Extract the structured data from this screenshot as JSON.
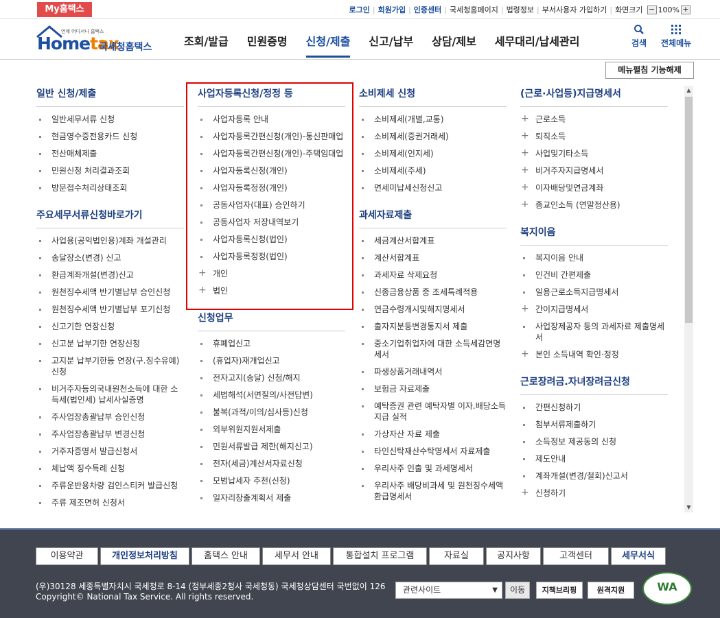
{
  "topbar": {
    "my_tab": "My홈택스",
    "links": [
      "로그인",
      "회원가입",
      "인증센터",
      "국세청홈페이지",
      "법령정보",
      "부서사용자 가입하기",
      "화면크기"
    ],
    "zoom": "100%"
  },
  "header": {
    "logo_small": "언제 어디서나 홈택스",
    "logo_text_1": "Home",
    "logo_text_2": "tax",
    "logo_kr": "국세청홈택스",
    "nav": [
      "조회/발급",
      "민원증명",
      "신청/제출",
      "신고/납부",
      "상담/제보",
      "세무대리/납세관리"
    ],
    "search_label": "검색",
    "allmenu_label": "전체메뉴"
  },
  "fold_button": "메뉴펼침 기능해제",
  "columns": [
    {
      "groups": [
        {
          "title": "일반 신청/제출",
          "items": [
            "일반세무서류 신청",
            "현금영수증전용카드 신청",
            "전산매체제출",
            "민원신청 처리결과조회",
            "방문접수처리상태조회"
          ]
        },
        {
          "title": "주요세무서류신청바로가기",
          "items": [
            "사업용(공익법인용)계좌 개설관리",
            "송달장소(변경) 신고",
            "환급계좌개설(변경)신고",
            "원천징수세액 반기별납부 승인신청",
            "원천징수세액 반기별납부 포기신청",
            "신고기한 연장신청",
            "신고분 납부기한 연장신청",
            "고지분 납부기한등 연장(구.징수유예) 신청",
            "비거주자등의국내원천소득에 대한 소득세(법인세) 납세사실증명",
            "주사업장총괄납부 승인신청",
            "주사업장총괄납부 변경신청",
            "거주자증명서 발급신청서",
            "체납액 징수특례 신청",
            "주류운반용차량 검인스티커 발급신청",
            "주류 제조면허 신청서"
          ]
        }
      ]
    },
    {
      "groups": [
        {
          "title": "사업자등록신청/정정 등",
          "items": [
            "사업자등록 안내",
            "사업자등록간편신청(개인)-통신판매업",
            "사업자등록간편신청(개인)-주택임대업",
            "사업자등록신청(개인)",
            "사업자등록정정(개인)",
            "공동사업자(대표) 승인하기",
            "공동사업자 저장내역보기",
            "사업자등록신청(법인)",
            "사업자등록정정(법인)",
            "개인",
            "법인"
          ],
          "plus": [
            9,
            10
          ]
        },
        {
          "title": "신청업무",
          "items": [
            "휴폐업신고",
            "(휴업자)재개업신고",
            "전자고지(송달) 신청/해지",
            "세법해석(서면질의/사전답변)",
            "불복(과적/이의/심사등)신청",
            "외부위원지원서제출",
            "민원서류발급 제한(해지신고)",
            "전자(세금)계산서자료신청",
            "모범납세자 추천(신청)",
            "일자리창출계획서 제출"
          ]
        }
      ]
    },
    {
      "groups": [
        {
          "title": "소비제세 신청",
          "items": [
            "소비제세(개별,교통)",
            "소비제세(증권거래세)",
            "소비제세(인지세)",
            "소비제세(주세)",
            "면세미납세신청신고"
          ]
        },
        {
          "title": "과세자료제출",
          "items": [
            "세금계산서합계표",
            "계산서합계표",
            "과세자료 삭제요청",
            "신종금융상품 중 조세특례적용",
            "연금수령개시및해지명세서",
            "출자지분등변경통지서 제출",
            "중소기업취업자에 대한 소득세감면명세서",
            "파생상품거래내역서",
            "보험금 자료제출",
            "예탁증권 관련 예탁자별 이자.배당소득 지급 실적",
            "가상자산 자료 제출",
            "타인신탁재산수탁명세서 자료제출",
            "우리사주 인출 및 과세명세서",
            "우리사주 배당비과세 및 원천징수세액 환급명세서"
          ]
        }
      ]
    },
    {
      "groups": [
        {
          "title": "(근로·사업등)지급명세서",
          "items": [
            "근로소득",
            "퇴직소득",
            "사업및기타소득",
            "비거주자지급명세서",
            "이자배당및연금계좌",
            "종교인소득 (연말정산용)"
          ],
          "plus": [
            0,
            1,
            2,
            3,
            4,
            5
          ]
        },
        {
          "title": "복지이음",
          "items": [
            "복지이음 안내",
            "인건비 간편제출",
            "일용근로소득지급명세서",
            "간이지급명세서",
            "사업장제공자 등의 과세자료 제출명세서",
            "본인 소득내역 확인·정정"
          ],
          "plus": [
            3,
            5
          ]
        },
        {
          "title": "근로장려금.자녀장려금신청",
          "items": [
            "간편신청하기",
            "첨부서류제출하기",
            "소득정보 제공동의 신청",
            "제도안내",
            "계좌개설(변경/철회)신고서",
            "신청하기"
          ],
          "plus": [
            5
          ]
        }
      ]
    }
  ],
  "footer": {
    "links": [
      "이용약관",
      "개인정보처리방침",
      "홈택스 안내",
      "세무서 안내",
      "통합설치 프로그램",
      "자료실",
      "공지사항",
      "고객센터",
      "세무서식"
    ],
    "address_line1": "(우)30128 세종특별자치시 국세청로 8-14 (정부세종2청사 국세청동) 국세청상담센터 국번없이 126",
    "address_line2": "Copyright© National Tax Service. All rights reserved.",
    "related_sites": "관련사이트",
    "go_button": "이동",
    "policy_btn": "지책브리핑",
    "remote_btn": "원격지원",
    "wa_text": "WA"
  }
}
